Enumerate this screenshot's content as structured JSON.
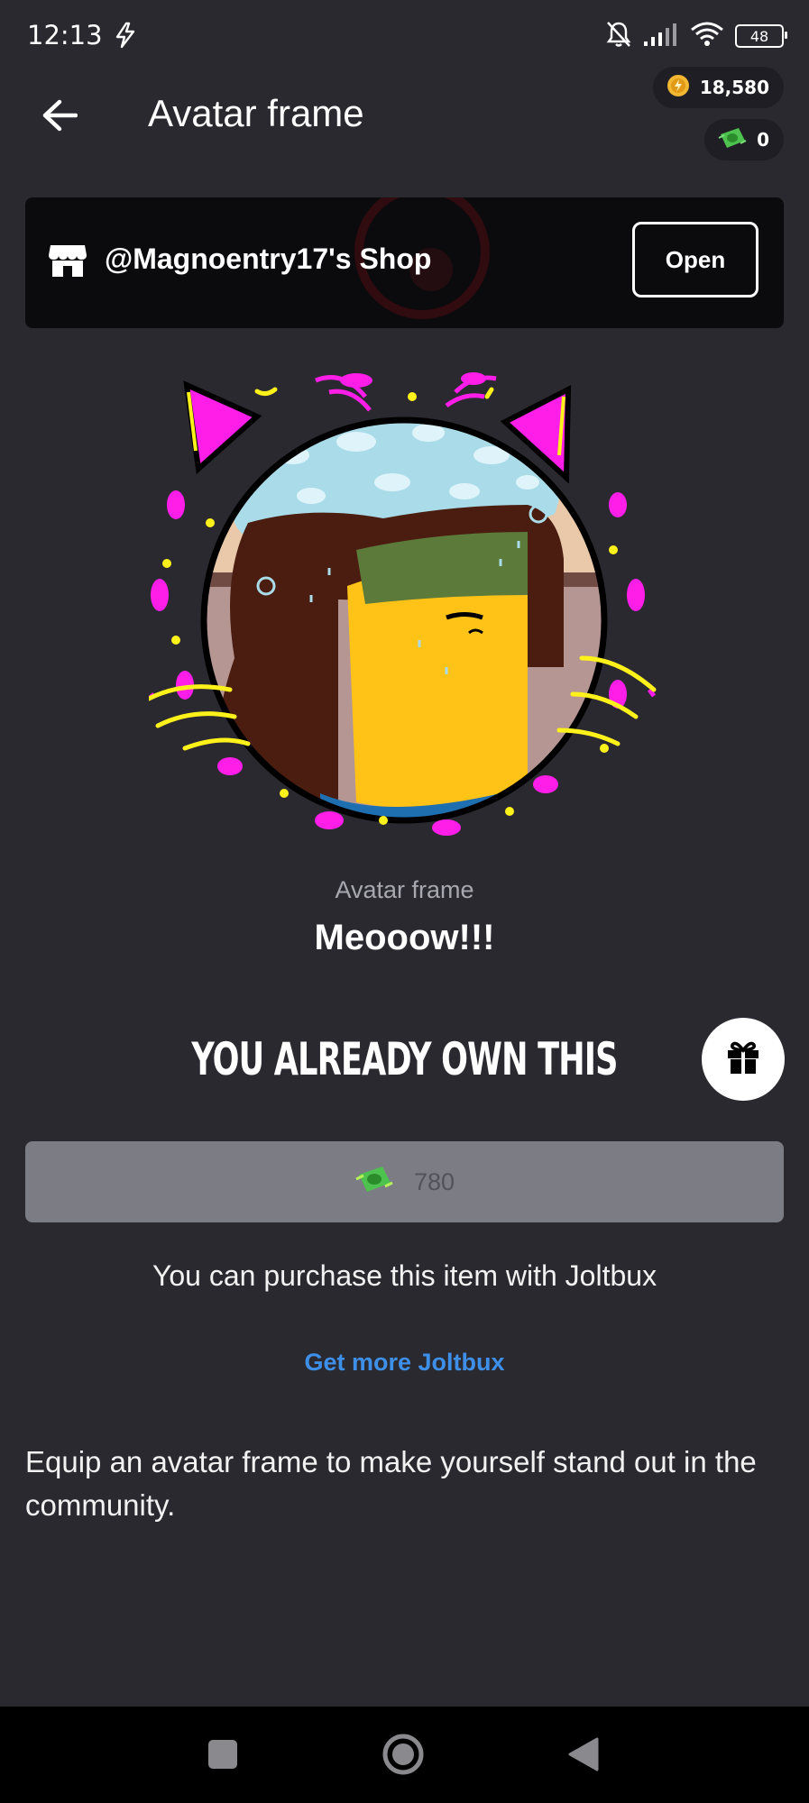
{
  "status_bar": {
    "time": "12:13",
    "battery": "48"
  },
  "wallet": {
    "coins": "18,580",
    "joltbux": "0"
  },
  "header": {
    "title": "Avatar frame"
  },
  "shop": {
    "name": "@Magnoentry17's Shop",
    "open_label": "Open"
  },
  "item": {
    "type": "Avatar frame",
    "name": "Meooow!!!",
    "ownership": "YOU ALREADY OWN THIS",
    "price": "780",
    "purchase_note": "You can purchase this item with Joltbux",
    "get_more_label": "Get more Joltbux",
    "description": "Equip an avatar frame to make yourself stand out in the community."
  },
  "colors": {
    "background": "#2a2930",
    "banner": "#0b0b0d",
    "price_button": "#7c7d84",
    "link": "#3d8fe8",
    "frame_magenta": "#ff1ee8",
    "frame_yellow": "#fff21a"
  },
  "icons": {
    "status": [
      "flash-icon",
      "bell-off-icon",
      "signal-icon",
      "wifi-icon",
      "battery-icon"
    ],
    "header": [
      "back-arrow-icon",
      "coin-icon",
      "joltbux-icon"
    ],
    "actions": [
      "store-icon",
      "gift-icon"
    ],
    "nav": [
      "square-icon",
      "home-circle-icon",
      "back-triangle-icon"
    ]
  }
}
